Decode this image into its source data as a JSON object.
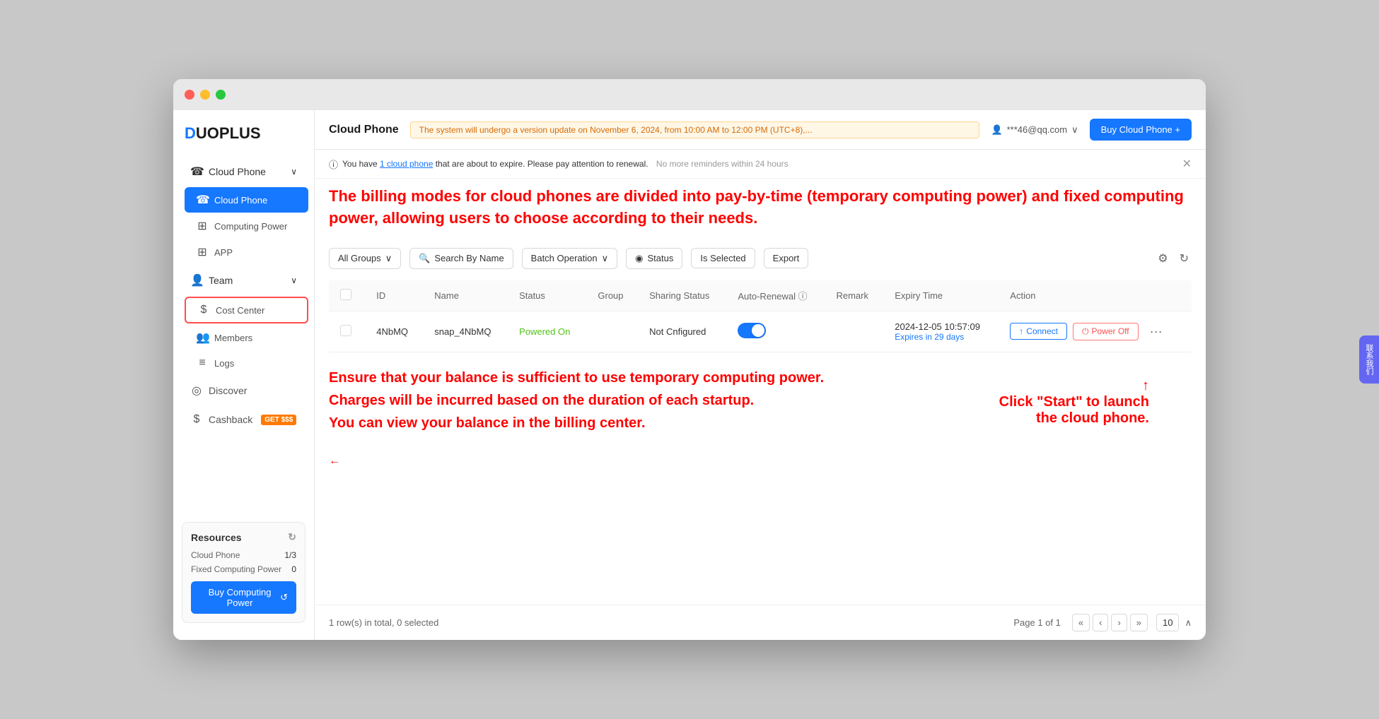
{
  "window": {
    "title": "DuoPlus Cloud Phone"
  },
  "logo": {
    "text_d": "D",
    "text_rest": "UOPLUS"
  },
  "topbar": {
    "title": "Cloud Phone",
    "notice": "The system will undergo a version update on November 6, 2024, from 10:00 AM to 12:00 PM (UTC+8),...",
    "user": "***46@qq.com",
    "buy_btn": "Buy Cloud Phone +"
  },
  "alert": {
    "text_before": "You have ",
    "link": "1 cloud phone",
    "text_after": " that are about to expire. Please pay attention to renewal.",
    "no_remind": "No more reminders within 24 hours"
  },
  "sidebar": {
    "cloud_phone_label": "Cloud Phone",
    "cloud_phone_sub_label": "Cloud Phone",
    "computing_power_label": "Computing Power",
    "app_label": "APP",
    "team_label": "Team",
    "cost_center_label": "Cost Center",
    "members_label": "Members",
    "logs_label": "Logs",
    "discover_label": "Discover",
    "cashback_label": "Cashback",
    "cashback_badge": "GET $$$"
  },
  "resources": {
    "title": "Resources",
    "cloud_phone_label": "Cloud Phone",
    "cloud_phone_val": "1/3",
    "fixed_computing_label": "Fixed Computing Power",
    "fixed_computing_val": "0",
    "buy_btn": "Buy Computing Power"
  },
  "filters": {
    "all_groups": "All Groups",
    "search_by_name": "Search By Name",
    "batch_operation": "Batch Operation",
    "status": "Status",
    "is_selected": "Is Selected",
    "export": "Export"
  },
  "table": {
    "columns": [
      "ID",
      "Name",
      "Status",
      "Group",
      "Sharing Status",
      "Auto-Renewal ⓘ",
      "Remark",
      "Expiry Time",
      "Action"
    ],
    "rows": [
      {
        "id": "4NbMQ",
        "name": "snap_4NbMQ",
        "status": "Powered On",
        "group": "",
        "sharing_status": "Not Cnfigured",
        "auto_renewal": true,
        "remark": "",
        "expiry_date": "2024-12-05 10:57:09",
        "expiry_sub": "Expires in 29 days"
      }
    ],
    "actions": {
      "connect": "Connect",
      "power_off": "Power Off"
    }
  },
  "footer": {
    "row_count": "1 row(s) in total, 0 selected",
    "page_label": "Page 1 of 1",
    "page_size": "10"
  },
  "annotations": {
    "billing_modes": "The billing modes for cloud phones are divided into pay-by-time (temporary computing power) and fixed computing power, allowing users to choose according to their needs.",
    "balance_note": "Ensure that your balance is sufficient to use temporary computing power.\nCharges will be incurred based on the duration of each startup.\nYou can view your balance in the billing center.",
    "start_note": "Click \"Start\" to launch\nthe cloud phone."
  },
  "contact_sidebar": {
    "label": "联系我们"
  }
}
